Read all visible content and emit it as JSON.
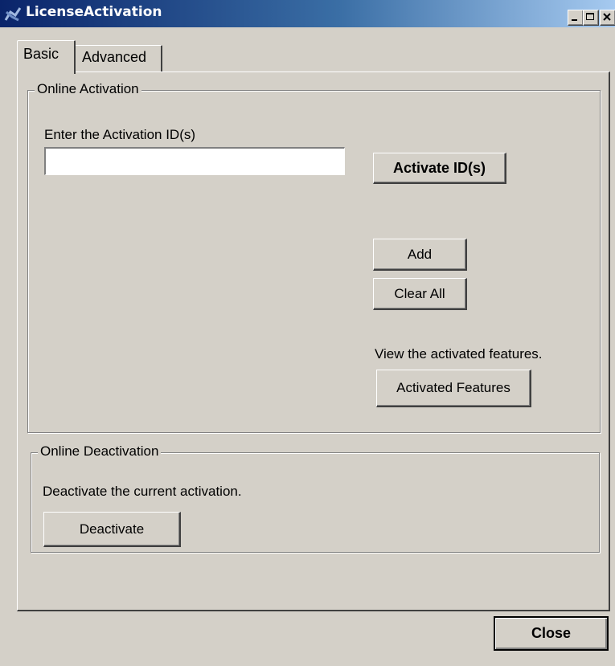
{
  "window": {
    "title": "LicenseActivation",
    "colors": {
      "title_start": "#0a246a",
      "title_end": "#a6caf0",
      "face": "#d4d0c8"
    },
    "icons": [
      "app-icon",
      "minimize-icon",
      "maximize-icon",
      "close-icon"
    ]
  },
  "tabs": [
    {
      "label": "Basic",
      "selected": true
    },
    {
      "label": "Advanced",
      "selected": false
    }
  ],
  "online_activation": {
    "group_label": "Online Activation",
    "prompt": "Enter the Activation ID(s)",
    "activation_id_value": "",
    "activate_button": "Activate ID(s)",
    "add_button": "Add",
    "clear_all_button": "Clear All",
    "view_text": "View the activated features.",
    "activated_features_button": "Activated Features"
  },
  "online_deactivation": {
    "group_label": "Online Deactivation",
    "text": "Deactivate the current activation.",
    "deactivate_button": "Deactivate"
  },
  "footer": {
    "close_button": "Close"
  }
}
